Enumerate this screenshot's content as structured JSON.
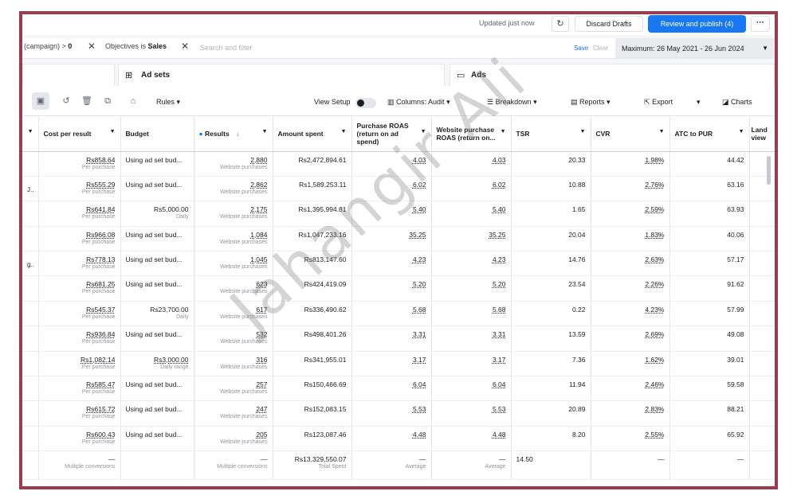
{
  "header": {
    "updated": "Updated just now",
    "discard_label": "Discard Drafts",
    "publish_label": "Review and publish (4)",
    "more_label": "···"
  },
  "filters": {
    "chip1_text": "(campaign) >",
    "chip1_value": "0",
    "chip2_text": "Objectives is",
    "chip2_value": "Sales",
    "search_placeholder": "Search and filter",
    "save_label": "Save",
    "clear_label": "Clear",
    "date_range": "Maximum: 26 May 2021 - 26 Jun 2024"
  },
  "tabs": {
    "ad_sets": "Ad sets",
    "ads": "Ads"
  },
  "toolbar": {
    "rules_label": "Rules",
    "view_setup_label": "View Setup",
    "columns_label": "Columns: Audit",
    "breakdown_label": "Breakdown",
    "reports_label": "Reports",
    "export_label": "Export",
    "charts_label": "Charts"
  },
  "columns": {
    "cost": "Cost per result",
    "budget": "Budget",
    "results": "Results",
    "amount": "Amount spent",
    "proas": "Purchase ROAS (return on ad spend)",
    "wproas": "Website purchase ROAS (return on...",
    "tsr": "TSR",
    "cvr": "CVR",
    "atc": "ATC to PUR",
    "land": "Land view"
  },
  "rows": [
    {
      "lead": "",
      "cost": "Rs858.64",
      "cost_sub": "Per purchase",
      "budget": "Using ad set bud...",
      "budget_sub": "",
      "results": "2,880",
      "results_sub": "Website purchases",
      "amount": "Rs2,472,894.61",
      "proas": "4.03",
      "wproas": "4.03",
      "tsr": "20.33",
      "cvr": "1.98%",
      "atc": "44.42"
    },
    {
      "lead": "J..",
      "cost": "Rs555.29",
      "cost_sub": "Per purchase",
      "budget": "Using ad set bud...",
      "budget_sub": "",
      "results": "2,862",
      "results_sub": "Website purchases",
      "amount": "Rs1,589,253.11",
      "proas": "6.02",
      "wproas": "6.02",
      "tsr": "10.88",
      "cvr": "2.76%",
      "atc": "63.16"
    },
    {
      "lead": "",
      "cost": "Rs641.84",
      "cost_sub": "Per purchase",
      "budget": "Rs5,000.00",
      "budget_sub": "Daily",
      "results": "2,175",
      "results_sub": "Website purchases",
      "amount": "Rs1,395,994.81",
      "proas": "5.40",
      "wproas": "5.40",
      "tsr": "1.65",
      "cvr": "2.59%",
      "atc": "63.93"
    },
    {
      "lead": "",
      "cost": "Rs966.08",
      "cost_sub": "Per purchase",
      "budget": "Using ad set bud...",
      "budget_sub": "",
      "results": "1,084",
      "results_sub": "Website purchases",
      "amount": "Rs1,047,233.16",
      "proas": "35.25",
      "wproas": "35.25",
      "tsr": "20.04",
      "cvr": "1.83%",
      "atc": "40.06"
    },
    {
      "lead": "g..",
      "cost": "Rs778.13",
      "cost_sub": "Per purchase",
      "budget": "Using ad set bud...",
      "budget_sub": "",
      "results": "1,045",
      "results_sub": "Website purchases",
      "amount": "Rs813,147.60",
      "proas": "4.23",
      "wproas": "4.23",
      "tsr": "14.76",
      "cvr": "2.63%",
      "atc": "57.17"
    },
    {
      "lead": "",
      "cost": "Rs681.25",
      "cost_sub": "Per purchase",
      "budget": "Using ad set bud...",
      "budget_sub": "",
      "results": "623",
      "results_sub": "Website purchases",
      "amount": "Rs424,419.09",
      "proas": "5.20",
      "wproas": "5.20",
      "tsr": "23.54",
      "cvr": "2.26%",
      "atc": "91.62"
    },
    {
      "lead": "",
      "cost": "Rs545.37",
      "cost_sub": "Per purchase",
      "budget": "Rs23,700.00",
      "budget_sub": "Daily",
      "results": "617",
      "results_sub": "Website purchases",
      "amount": "Rs336,490.62",
      "proas": "5.68",
      "wproas": "5.68",
      "tsr": "0.22",
      "cvr": "4.23%",
      "atc": "57.99"
    },
    {
      "lead": "",
      "cost": "Rs936.84",
      "cost_sub": "Per purchase",
      "budget": "Using ad set bud...",
      "budget_sub": "",
      "results": "532",
      "results_sub": "Website purchases",
      "amount": "Rs498,401.26",
      "proas": "3.31",
      "wproas": "3.31",
      "tsr": "13.59",
      "cvr": "2.69%",
      "atc": "49.08"
    },
    {
      "lead": "",
      "cost": "Rs1,082.14",
      "cost_sub": "Per purchase",
      "budget": "Rs3,000.00",
      "budget_sub": "Daily range",
      "results": "316",
      "results_sub": "Website purchases",
      "amount": "Rs341,955.01",
      "proas": "3.17",
      "wproas": "3.17",
      "tsr": "7.36",
      "cvr": "1.62%",
      "atc": "39.01"
    },
    {
      "lead": "",
      "cost": "Rs585.47",
      "cost_sub": "Per purchase",
      "budget": "Using ad set bud...",
      "budget_sub": "",
      "results": "257",
      "results_sub": "Website purchases",
      "amount": "Rs150,466.69",
      "proas": "6.04",
      "wproas": "6.04",
      "tsr": "11.94",
      "cvr": "2.46%",
      "atc": "59.58"
    },
    {
      "lead": "",
      "cost": "Rs615.72",
      "cost_sub": "Per purchase",
      "budget": "Using ad set bud...",
      "budget_sub": "",
      "results": "247",
      "results_sub": "Website purchases",
      "amount": "Rs152,083.15",
      "proas": "5.53",
      "wproas": "5.53",
      "tsr": "20.89",
      "cvr": "2.83%",
      "atc": "88.21"
    },
    {
      "lead": "",
      "cost": "Rs600.43",
      "cost_sub": "Per purchase",
      "budget": "Using ad set bud...",
      "budget_sub": "",
      "results": "205",
      "results_sub": "Website purchases",
      "amount": "Rs123,087.46",
      "proas": "4.48",
      "wproas": "4.48",
      "tsr": "8.20",
      "cvr": "2.55%",
      "atc": "65.92"
    }
  ],
  "totals": {
    "cost": "—",
    "cost_sub": "Multiple conversions",
    "results": "—",
    "results_sub": "Multiple conversions",
    "amount": "Rs13,329,550.07",
    "amount_sub": "Total Spent",
    "proas": "—",
    "proas_sub": "Average",
    "wproas": "—",
    "wproas_sub": "Average",
    "tsr": "14.50",
    "cvr": "—",
    "atc": "—"
  },
  "watermark": "Jahangir Ali",
  "colors": {
    "frame": "#9b3b4f",
    "accent": "#1877f2"
  }
}
